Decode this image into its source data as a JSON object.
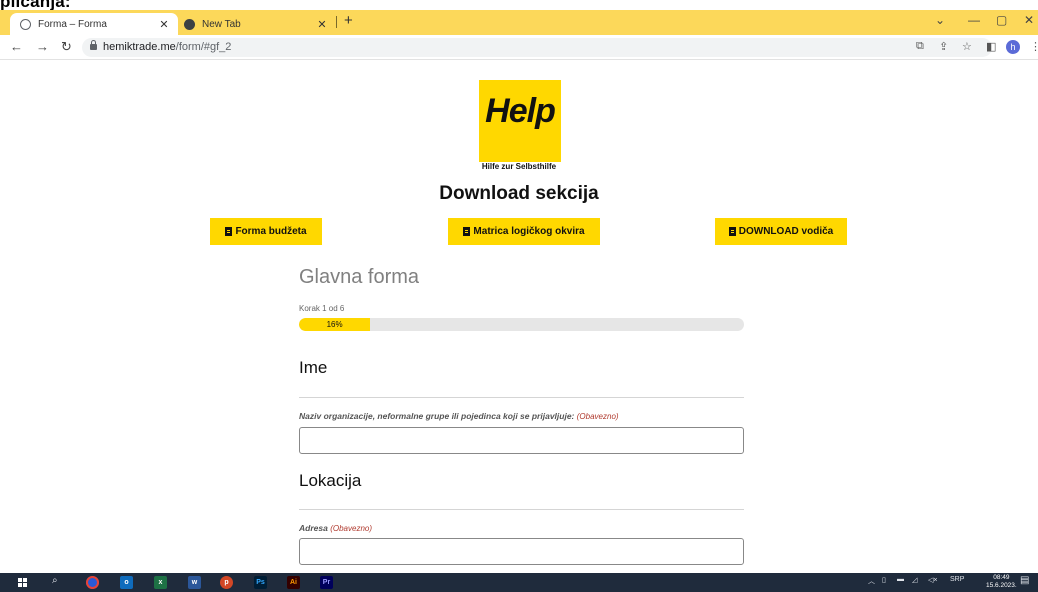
{
  "clipped_heading": "plicanja:",
  "browser": {
    "tabs": [
      {
        "title": "Forma – Forma",
        "active": true
      },
      {
        "title": "New Tab",
        "active": false
      }
    ],
    "url_host": "hemiktrade.me",
    "url_path": "/form/#gf_2",
    "profile_initial": "h"
  },
  "page": {
    "logo_word": "Help",
    "logo_tagline": "Hilfe zur Selbsthilfe",
    "section_title": "Download sekcija",
    "buttons": {
      "budget": "Forma budžeta",
      "matrix": "Matrica logičkog okvira",
      "guide": "DOWNLOAD vodiča"
    }
  },
  "form": {
    "title": "Glavna forma",
    "step_text": "Korak 1 od 6",
    "progress_percent": 16,
    "progress_label": "16%",
    "section_name": "Ime",
    "org_label": "Naziv organizacije, neformalne grupe ili pojedinca koji se prijavljuje:",
    "required_text": "(Obavezno)",
    "section_location": "Lokacija",
    "address_label": "Adresa",
    "org_value": "",
    "address_value": ""
  },
  "taskbar": {
    "apps": [
      "chrome",
      "outlook",
      "excel",
      "word",
      "powerpoint",
      "photoshop",
      "illustrator",
      "premiere"
    ],
    "language": "SRP",
    "time": "08:49",
    "date": "15.6.2023."
  },
  "colors": {
    "tab_strip": "#fcd85a",
    "brand_yellow": "#ffd800",
    "taskbar": "#1f2b3c",
    "required_red": "#b03a2e"
  }
}
